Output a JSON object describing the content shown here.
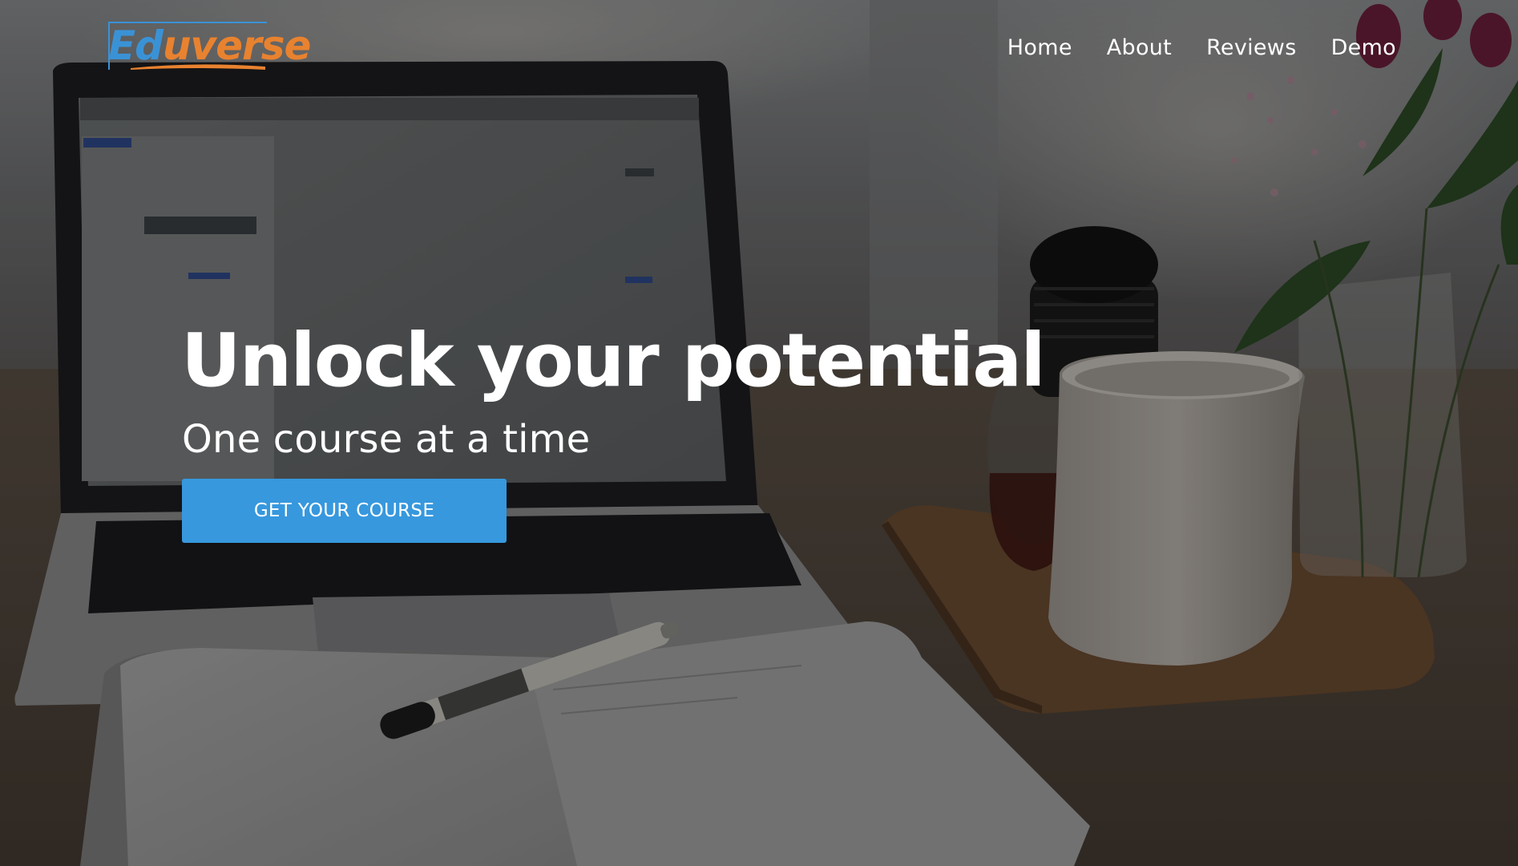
{
  "brand": {
    "logo_text": "Eduverse",
    "logo_first_letters": "Ed",
    "logo_rest": "uverse",
    "logo_colors": {
      "blue": "#3a92d6",
      "orange": "#e8822f"
    }
  },
  "nav": {
    "items": [
      {
        "label": "Home"
      },
      {
        "label": "About"
      },
      {
        "label": "Reviews"
      },
      {
        "label": "Demo"
      }
    ]
  },
  "hero": {
    "headline": "Unlock your potential",
    "subheadline": "One course at a time",
    "cta_label": "GET YOUR COURSE",
    "cta_color": "#3798de",
    "background_image": "desk-laptop-notebook-mug-flowers"
  }
}
